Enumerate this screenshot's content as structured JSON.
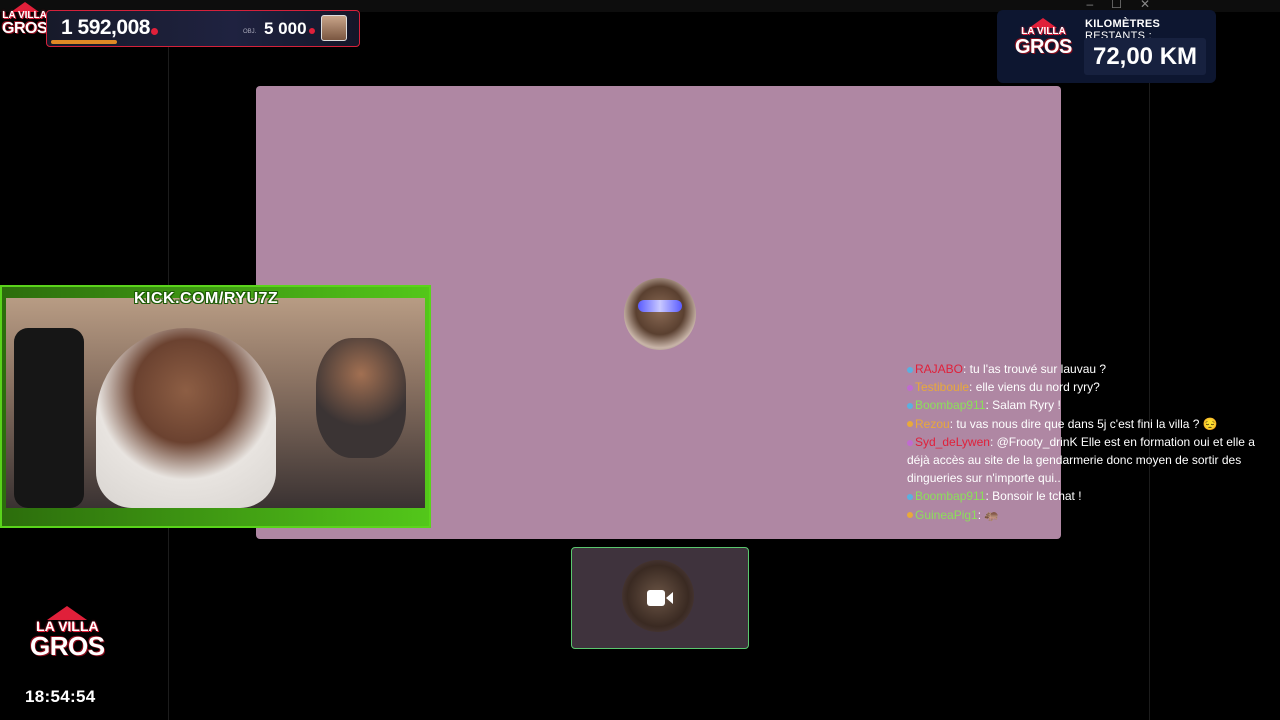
{
  "window": {
    "controls": [
      "–",
      "☐",
      "✕"
    ]
  },
  "top_left": {
    "logo": {
      "line1": "LA VILLA",
      "line2": "GROS"
    },
    "main_amount": "1 592,008",
    "objective_label": "OBJ.",
    "objective_amount": "5 000",
    "progress": 0.2,
    "accent_color": "#e0203a"
  },
  "km_panel": {
    "logo": {
      "line1": "LA VILLA",
      "line2": "GROS"
    },
    "label_bold": "KILOMÈTRES",
    "label_light": "RESTANTS :",
    "value": "72,00 KM"
  },
  "webcam": {
    "overlay_text": "KICK.COM/RYU7Z",
    "frame_color": "#5ad41b"
  },
  "call": {
    "main_tile_color": "#af87a3",
    "self_tile_icon": "camera-icon"
  },
  "chat": {
    "messages": [
      {
        "user": "RAJABO",
        "color": "#e0203a",
        "text": ": tu l'as trouvé sur lauvau ?"
      },
      {
        "user": "Testiboule",
        "color": "#e8a93a",
        "text": ": elle viens du nord ryry?"
      },
      {
        "user": "Boombap911",
        "color": "#8be05a",
        "text": ": Salam Ryry !"
      },
      {
        "user": "Rezou",
        "color": "#e8a93a",
        "text": ": tu vas nous dire que dans 5j c'est fini la villa ? 😔"
      },
      {
        "user": "Syd_deLywen",
        "color": "#e0203a",
        "text": ": @Frooty_drinK Elle est en formation oui et elle a déjà accès au site de la gendarmerie donc moyen de sortir des dingueries sur n'importe qui.."
      },
      {
        "user": "Boombap911",
        "color": "#8be05a",
        "text": ": Bonsoir le tchat !"
      },
      {
        "user": "GuineaPig1",
        "color": "#8be05a",
        "text": ": 🦛"
      }
    ]
  },
  "bottom_left": {
    "logo": {
      "line1": "LA VILLA",
      "line2": "GROS"
    },
    "clock": "18:54:54"
  }
}
